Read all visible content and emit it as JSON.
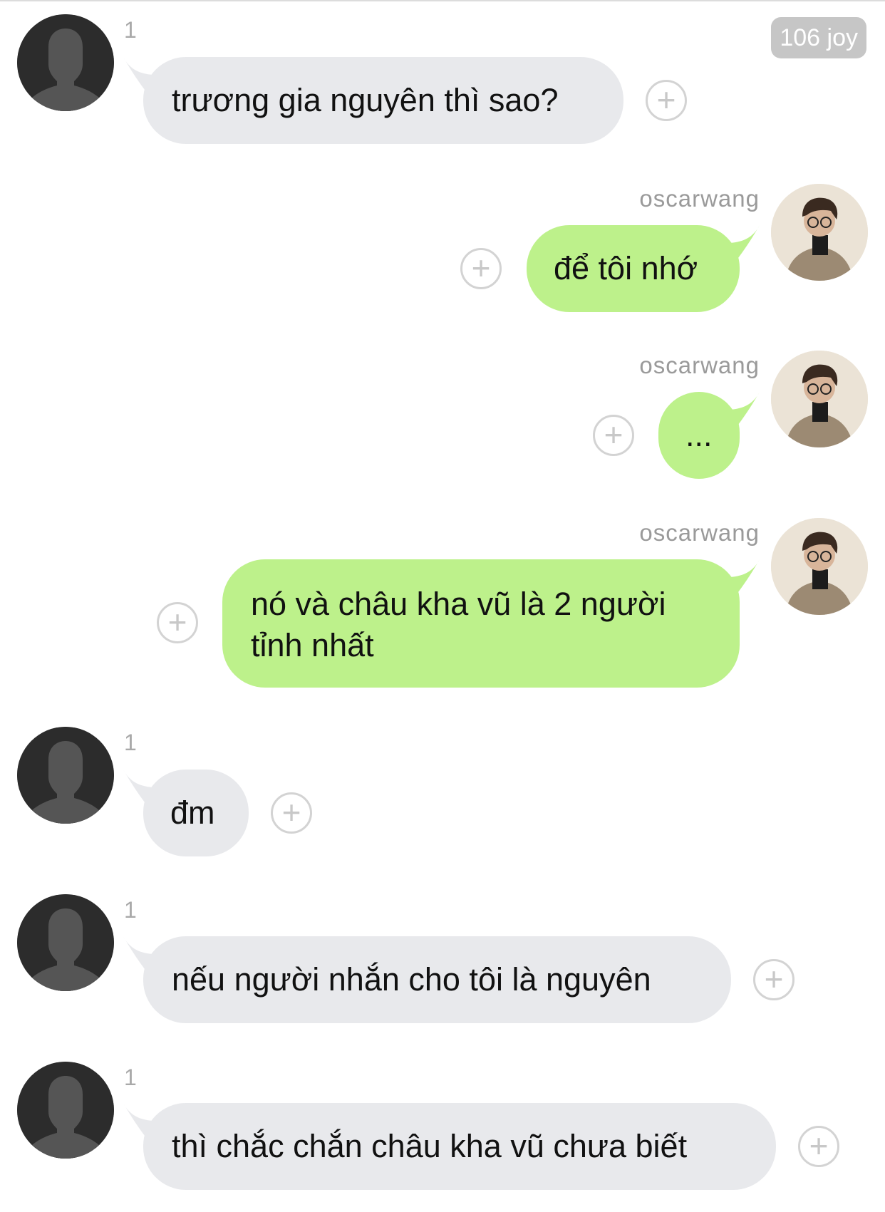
{
  "header": {
    "badge": "106 joy"
  },
  "messages": [
    {
      "side": "in",
      "count": "1",
      "text": "trương gia nguyên thì sao?"
    },
    {
      "side": "out",
      "sender": "oscarwang",
      "text": "để tôi nhớ"
    },
    {
      "side": "out",
      "sender": "oscarwang",
      "text": "..."
    },
    {
      "side": "out",
      "sender": "oscarwang",
      "line1": "nó và châu kha vũ là 2 người",
      "line2": "tỉnh nhất"
    },
    {
      "side": "in",
      "count": "1",
      "text": "đm"
    },
    {
      "side": "in",
      "count": "1",
      "text": "nếu người nhắn cho tôi là nguyên"
    },
    {
      "side": "in",
      "count": "1",
      "text": "thì chắc chắn châu kha vũ chưa biết"
    }
  ],
  "icons": {
    "add": "plus-circle-icon",
    "avatar_default": "default-person-icon",
    "avatar_user": "user-photo"
  },
  "plus_glyph": "+",
  "colors": {
    "incoming_bubble": "#e8e9ec",
    "outgoing_bubble": "#bdf18b",
    "background": "#ffffff",
    "badge": "#c6c6c6"
  }
}
